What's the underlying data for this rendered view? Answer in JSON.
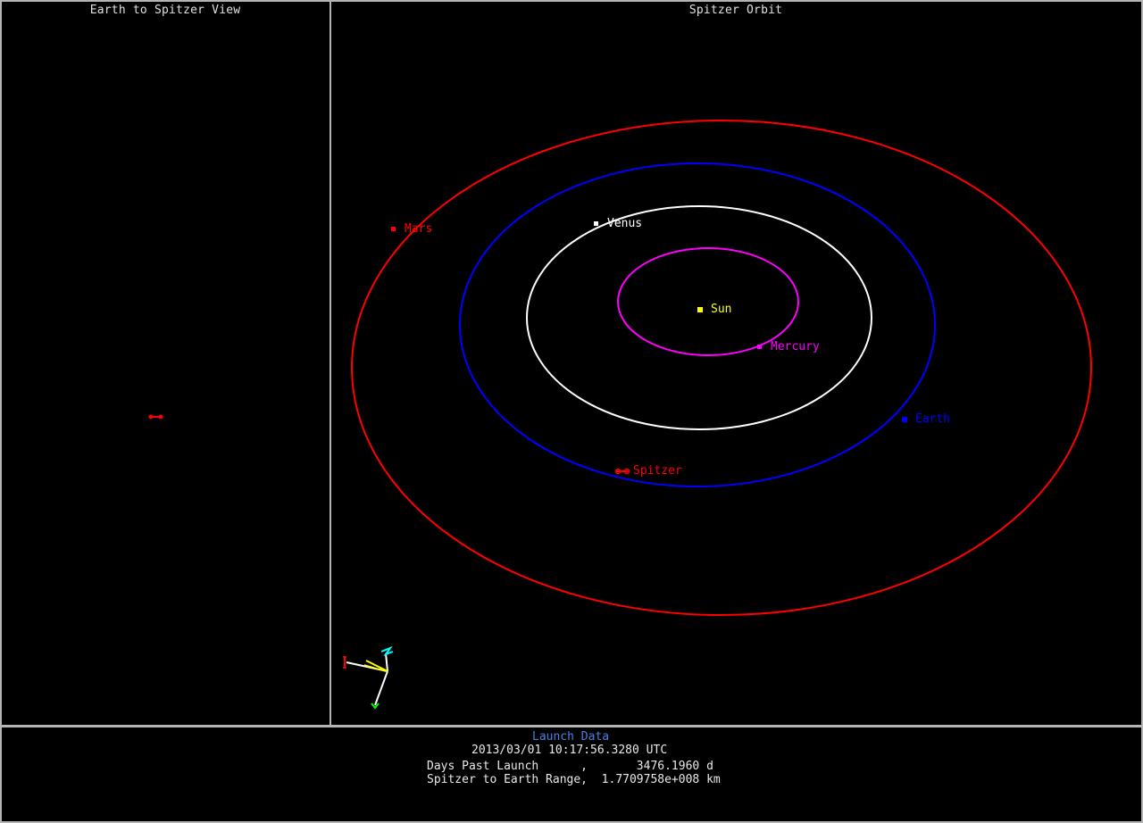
{
  "panels": {
    "left_title": "Earth to Spitzer View",
    "right_title": "Spitzer Orbit"
  },
  "bodies": {
    "sun": {
      "label": "Sun",
      "color": "#ffff00"
    },
    "mercury": {
      "label": "Mercury",
      "color": "#ff00ff"
    },
    "venus": {
      "label": "Venus",
      "color": "#ffffff"
    },
    "earth": {
      "label": "Earth",
      "color": "#0000ff"
    },
    "mars": {
      "label": "Mars",
      "color": "#ff0000"
    },
    "spitzer": {
      "label": "Spitzer",
      "color": "#ff0000"
    }
  },
  "info": {
    "title": "Launch Data",
    "timestamp": "2013/03/01 10:17:56.3280 UTC",
    "days_past_launch": "Days Past Launch      ,       3476.1960 d",
    "range": "Spitzer to Earth Range,  1.7709758e+008 km"
  },
  "colors": {
    "border": "#b4b4b4",
    "info_title": "#4a7fe0"
  }
}
